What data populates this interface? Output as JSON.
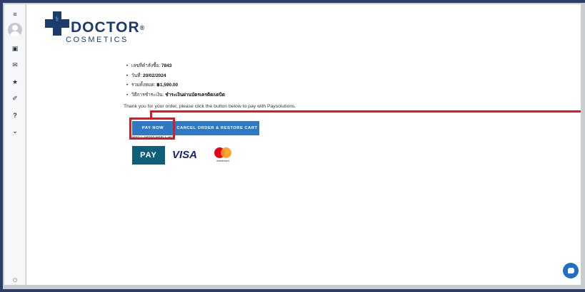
{
  "sidebar": {
    "top_icon": "menu-icon",
    "items": [
      {
        "icon": "book-icon",
        "glyph": "▣"
      },
      {
        "icon": "mail-icon",
        "glyph": "✉"
      },
      {
        "icon": "star-icon",
        "glyph": "★"
      },
      {
        "icon": "pin-icon",
        "glyph": "✐"
      },
      {
        "icon": "help-icon",
        "glyph": "?"
      },
      {
        "icon": "chevrons-down-icon",
        "glyph": "⌄"
      }
    ],
    "bottom_icon": "power-icon"
  },
  "brand": {
    "name_line1": "DOCTOR",
    "reg_mark": "®",
    "name_line2": "COSMETICS",
    "primary_color": "#1d3c6e",
    "accent_color": "#6fb3e6"
  },
  "order": {
    "number_label": "เลขที่คำสั่งซื้อ:",
    "number_value": "7843",
    "date_label": "วันที่:",
    "date_value": "20/02/2024",
    "total_label": "รวมทั้งหมด:",
    "total_value": "฿1,590.00",
    "payment_label": "วิธีการชำระเงิน:",
    "payment_value": "ชำระเงินผ่านบัตรเครดิต/เดบิต"
  },
  "message": "Thank you for your order, please click the button below to pay with Paysolutions.",
  "buttons": {
    "pay_now": "PAY NOW",
    "cancel": "CANCEL ORDER & RESTORE CART",
    "color": "#2e78c4"
  },
  "payment_option_label": "with Credit/Debit Card",
  "payment_logos": {
    "pay_badge": "PAY",
    "visa": "VISA",
    "mastercard_text": "mastercard"
  },
  "highlight_color": "#d11e27",
  "chat_icon": "chat-icon"
}
